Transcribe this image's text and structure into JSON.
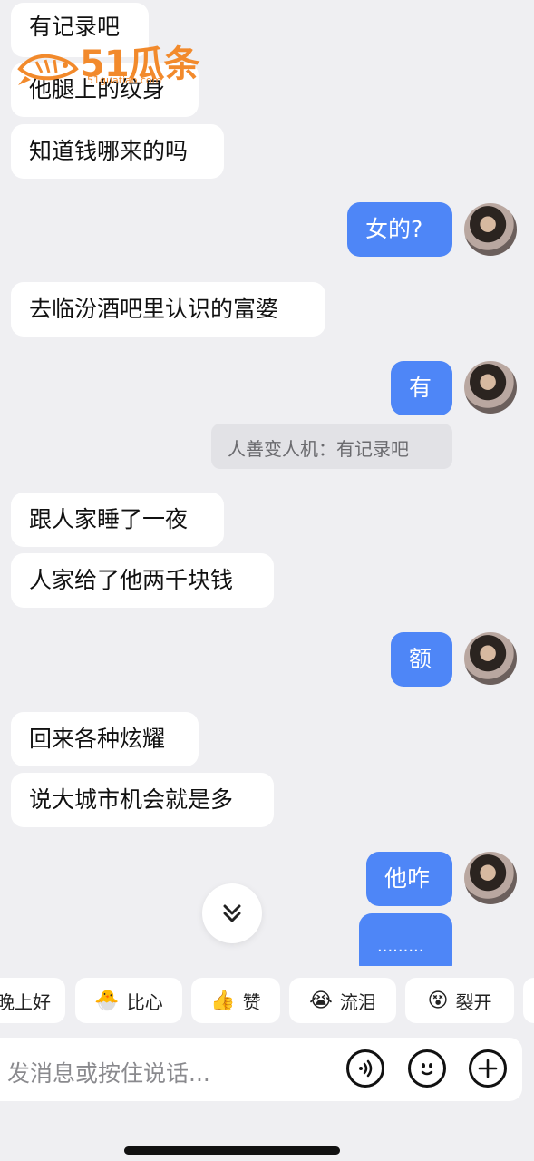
{
  "watermark": {
    "brand": "51瓜条",
    "sub": "51guatiao.com"
  },
  "messages": [
    {
      "side": "left",
      "text": "有记录吧"
    },
    {
      "side": "left",
      "text": "他腿上的纹身"
    },
    {
      "side": "left",
      "text": "知道钱哪来的吗"
    },
    {
      "side": "right",
      "text": "女的?"
    },
    {
      "side": "left",
      "text": "去临汾酒吧里认识的富婆"
    },
    {
      "side": "right",
      "text": "有"
    },
    {
      "side": "quote",
      "text": "人善变人机：有记录吧"
    },
    {
      "side": "left",
      "text": "跟人家睡了一夜"
    },
    {
      "side": "left",
      "text": "人家给了他两千块钱"
    },
    {
      "side": "right",
      "text": "额"
    },
    {
      "side": "left",
      "text": "回来各种炫耀"
    },
    {
      "side": "left",
      "text": "说大城市机会就是多"
    },
    {
      "side": "right",
      "text": "他咋"
    },
    {
      "side": "right",
      "text": "........."
    }
  ],
  "reactions": [
    {
      "label": "晚上好",
      "emoji": ""
    },
    {
      "label": "比心",
      "emoji": "🐣"
    },
    {
      "label": "赞",
      "emoji": "👍"
    },
    {
      "label": "流泪",
      "emoji": "😭"
    },
    {
      "label": "裂开",
      "emoji": "😵"
    }
  ],
  "input": {
    "placeholder": "发消息或按住说话..."
  },
  "icons": {
    "voice": "voice-icon",
    "emoji": "emoji-icon",
    "add": "plus-icon",
    "scroll": "chevron-double-down-icon"
  }
}
